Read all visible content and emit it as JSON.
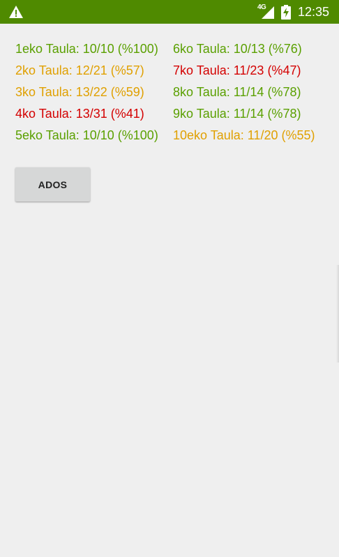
{
  "status_bar": {
    "network_label": "4G",
    "time": "12:35",
    "background": "#4f8a00"
  },
  "results": {
    "left": [
      {
        "text": "1eko Taula: 10/10 (%100)",
        "color": "#5aa000"
      },
      {
        "text": "2ko Taula: 12/21 (%57)",
        "color": "#e0a000"
      },
      {
        "text": "3ko Taula: 13/22 (%59)",
        "color": "#e0a000"
      },
      {
        "text": "4ko Taula: 13/31 (%41)",
        "color": "#d40000"
      },
      {
        "text": "5eko Taula: 10/10 (%100)",
        "color": "#5aa000"
      }
    ],
    "right": [
      {
        "text": "6ko Taula: 10/13 (%76)",
        "color": "#5aa000"
      },
      {
        "text": "7ko Taula: 11/23 (%47)",
        "color": "#d40000"
      },
      {
        "text": "8ko Taula: 11/14 (%78)",
        "color": "#5aa000"
      },
      {
        "text": "9ko Taula: 11/14 (%78)",
        "color": "#5aa000"
      },
      {
        "text": "10eko Taula: 11/20 (%55)",
        "color": "#e0a000"
      }
    ]
  },
  "ados_button": {
    "label": "ADOS"
  },
  "icons": {
    "warning": "warning-icon",
    "signal": "signal-icon",
    "battery": "battery-charging-icon"
  }
}
